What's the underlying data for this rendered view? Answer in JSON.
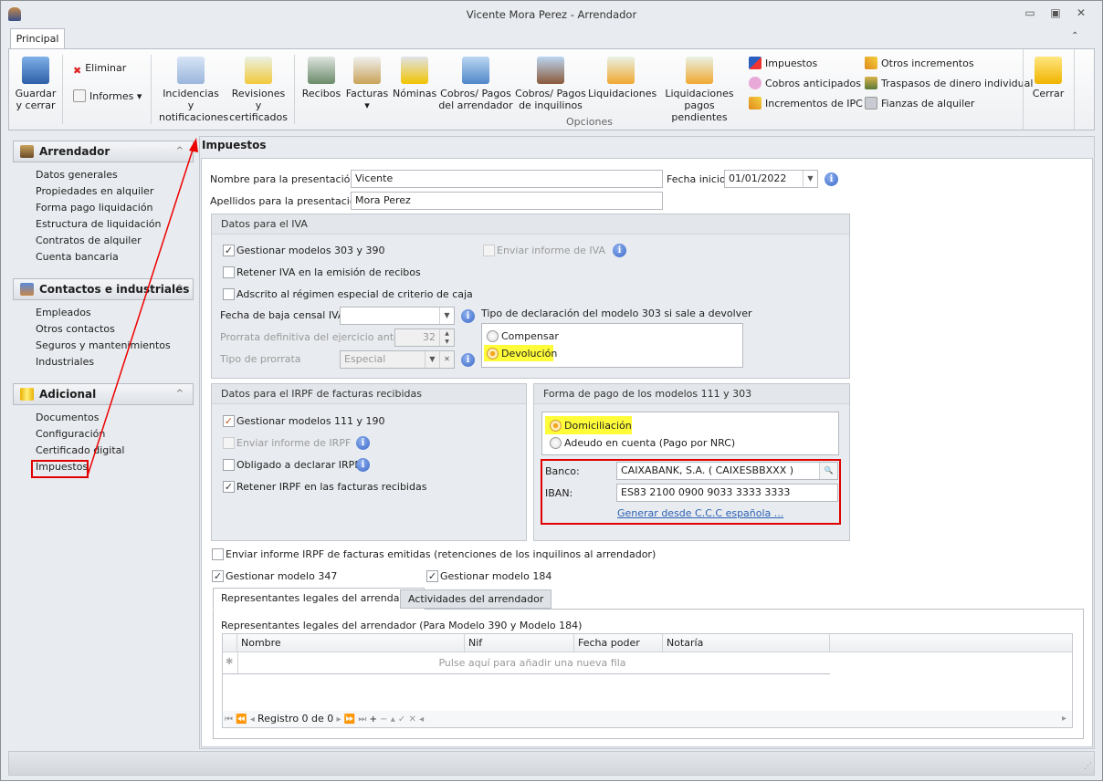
{
  "window": {
    "title": "Vicente Mora Perez - Arrendador"
  },
  "ribbon": {
    "tab": "Principal",
    "guardar": "Guardar y cerrar",
    "eliminar": "Eliminar",
    "informes": "Informes",
    "incidencias": "Incidencias y notificaciones",
    "revisiones": "Revisiones y certificados",
    "recibos": "Recibos",
    "facturas": "Facturas",
    "nominas": "Nóminas",
    "cobros_arrendador": "Cobros/ Pagos del arrendador",
    "cobros_inquilinos": "Cobros/ Pagos de inquilinos",
    "liquidaciones": "Liquidaciones",
    "liq_pendientes": "Liquidaciones pagos pendientes",
    "impuestos": "Impuestos",
    "cobros_anticipados": "Cobros anticipados",
    "incrementos_ipc": "Incrementos de IPC",
    "otros_incrementos": "Otros incrementos",
    "traspasos": "Traspasos de dinero individual",
    "fianzas": "Fianzas de alquiler",
    "group_label": "Opciones",
    "cerrar": "Cerrar"
  },
  "sidebar": {
    "groups": [
      {
        "title": "Arrendador",
        "items": [
          "Datos generales",
          "Propiedades en alquiler",
          "Forma pago liquidación",
          "Estructura de liquidación",
          "Contratos de alquiler",
          "Cuenta bancaria"
        ]
      },
      {
        "title": "Contactos e industriales",
        "items": [
          "Empleados",
          "Otros contactos",
          "Seguros y mantenimientos",
          "Industriales"
        ]
      },
      {
        "title": "Adicional",
        "items": [
          "Documentos",
          "Configuración",
          "Certificado digital",
          "Impuestos"
        ]
      }
    ]
  },
  "main": {
    "title": "Impuestos",
    "nombre_label": "Nombre para la presentación:",
    "nombre": "Vicente",
    "fecha_label": "Fecha inicio:",
    "fecha": "01/01/2022",
    "apellidos_label": "Apellidos para la presentación:",
    "apellidos": "Mora Perez",
    "iva": {
      "title": "Datos para el IVA",
      "gestionar": "Gestionar modelos 303 y 390",
      "enviar": "Enviar informe de IVA",
      "retener": "Retener IVA en la emisión de recibos",
      "adscrito": "Adscrito al régimen especial de criterio de caja",
      "fecha_baja": "Fecha de baja censal IVA",
      "prorrata": "Prorrata definitiva del ejercicio anterior",
      "prorrata_val": "32",
      "tipo_prorrata": "Tipo de prorrata",
      "tipo_prorrata_val": "Especial",
      "tipo_decl": "Tipo de declaración del modelo 303 si sale a devolver",
      "compensar": "Compensar",
      "devolucion": "Devolución"
    },
    "irpf": {
      "title": "Datos para el IRPF de facturas recibidas",
      "gestionar": "Gestionar modelos 111 y 190",
      "enviar": "Enviar informe de IRPF",
      "obligado": "Obligado a declarar IRPF",
      "retener": "Retener IRPF en las facturas recibidas"
    },
    "pago": {
      "title": "Forma de pago de los modelos 111 y 303",
      "domiciliacion": "Domiciliación",
      "adeudo": "Adeudo en cuenta (Pago por NRC)",
      "banco_label": "Banco:",
      "banco": "CAIXABANK, S.A. ( CAIXESBBXXX )",
      "iban_label": "IBAN:",
      "iban": "ES83 2100 0900 9033 3333 3333",
      "generar": "Generar desde C.C.C española ..."
    },
    "enviar_emitidas": "Enviar informe IRPF de facturas emitidas (retenciones de los inquilinos al arrendador)",
    "modelo347": "Gestionar modelo 347",
    "modelo184": "Gestionar modelo 184",
    "tabs": [
      "Representantes legales del arrendador",
      "Actividades del arrendador"
    ],
    "grid": {
      "caption": "Representantes legales del arrendador (Para Modelo 390 y Modelo 184)",
      "columns": [
        "Nombre",
        "Nif",
        "Fecha poder",
        "Notaría"
      ],
      "new_row": "Pulse aquí para añadir una nueva fila",
      "record": "Registro 0 de 0"
    }
  }
}
